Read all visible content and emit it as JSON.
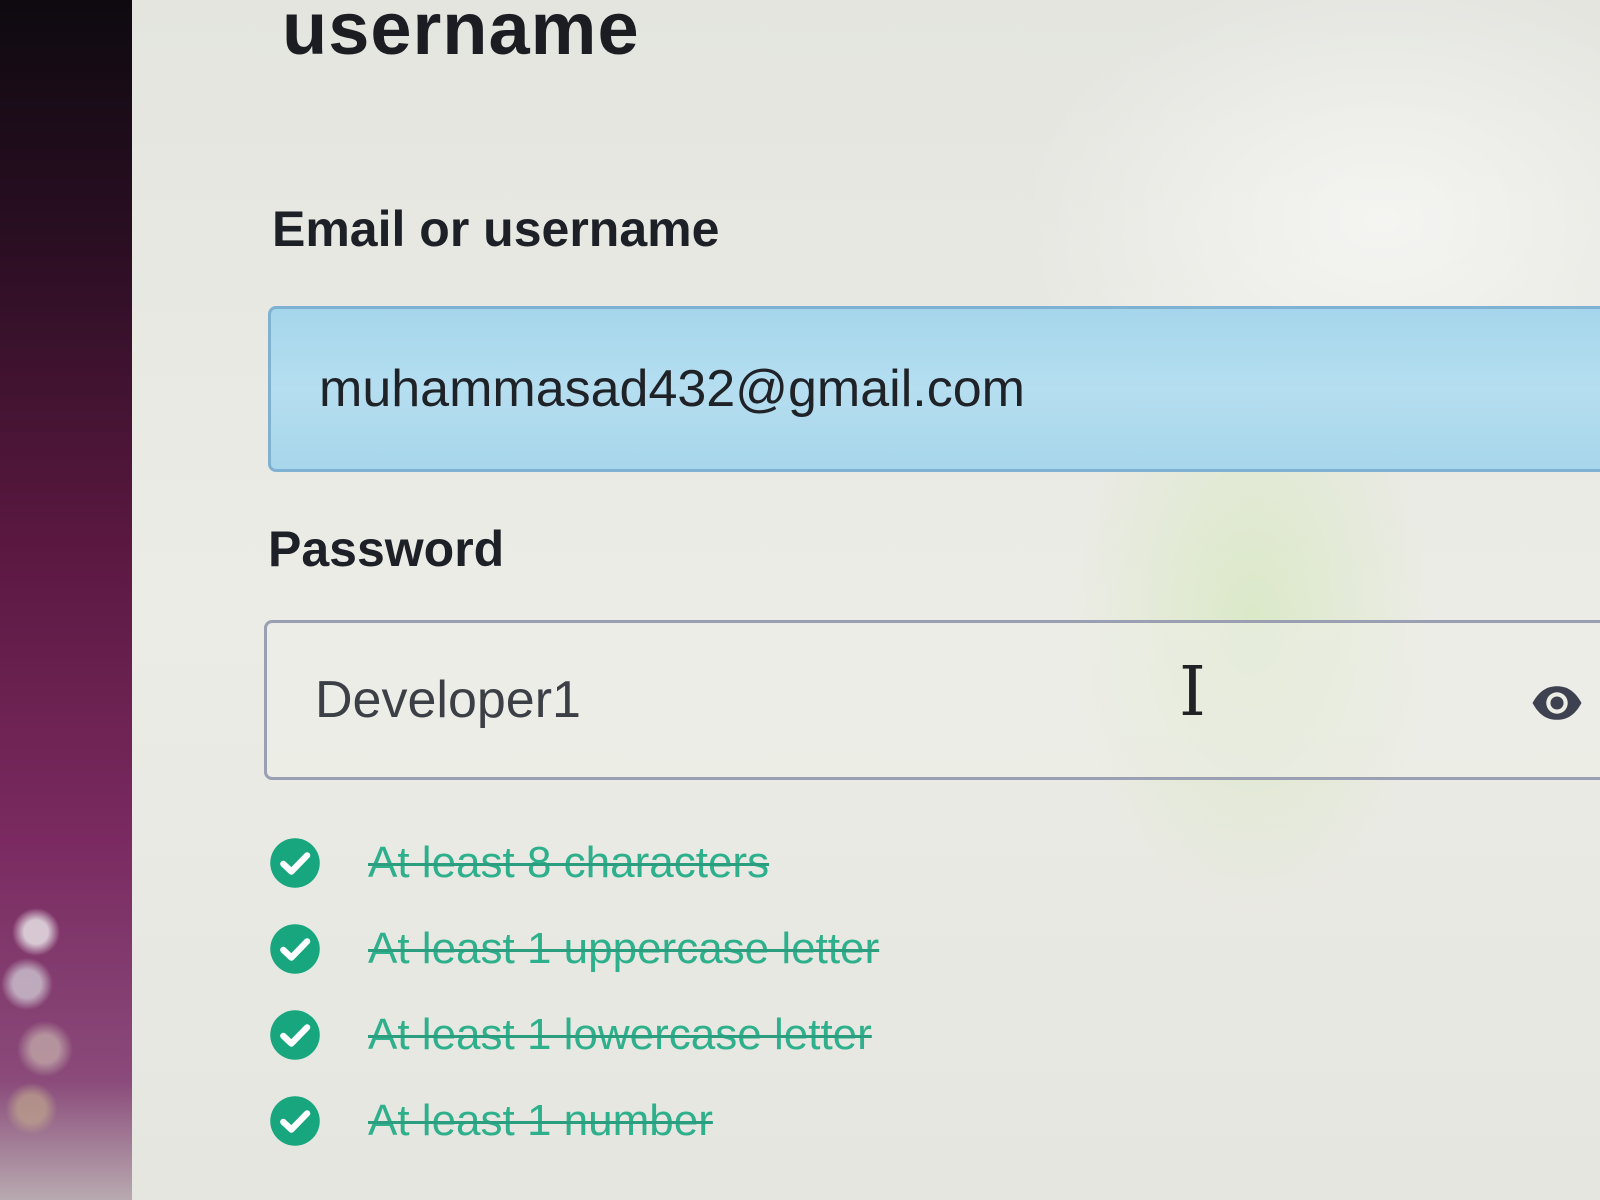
{
  "header": {
    "title": "username"
  },
  "form": {
    "email_label": "Email or username",
    "email_value": "muhammasad432@gmail.com",
    "password_label": "Password",
    "password_value": "Developer1"
  },
  "password_rules": [
    {
      "text": "At least 8 characters",
      "met": true
    },
    {
      "text": "At least 1 uppercase letter",
      "met": true
    },
    {
      "text": "At least 1 lowercase letter",
      "met": true
    },
    {
      "text": "At least 1 number",
      "met": true
    }
  ],
  "icons": {
    "visibility_toggle": "eye-icon",
    "rule_met": "check-circle-icon",
    "cursor": "text-cursor-icon"
  },
  "colors": {
    "success": "#17a67e",
    "email_field_fill": "#b0dbef",
    "email_field_border": "#7fb1d2",
    "text_primary": "#1d2026"
  }
}
